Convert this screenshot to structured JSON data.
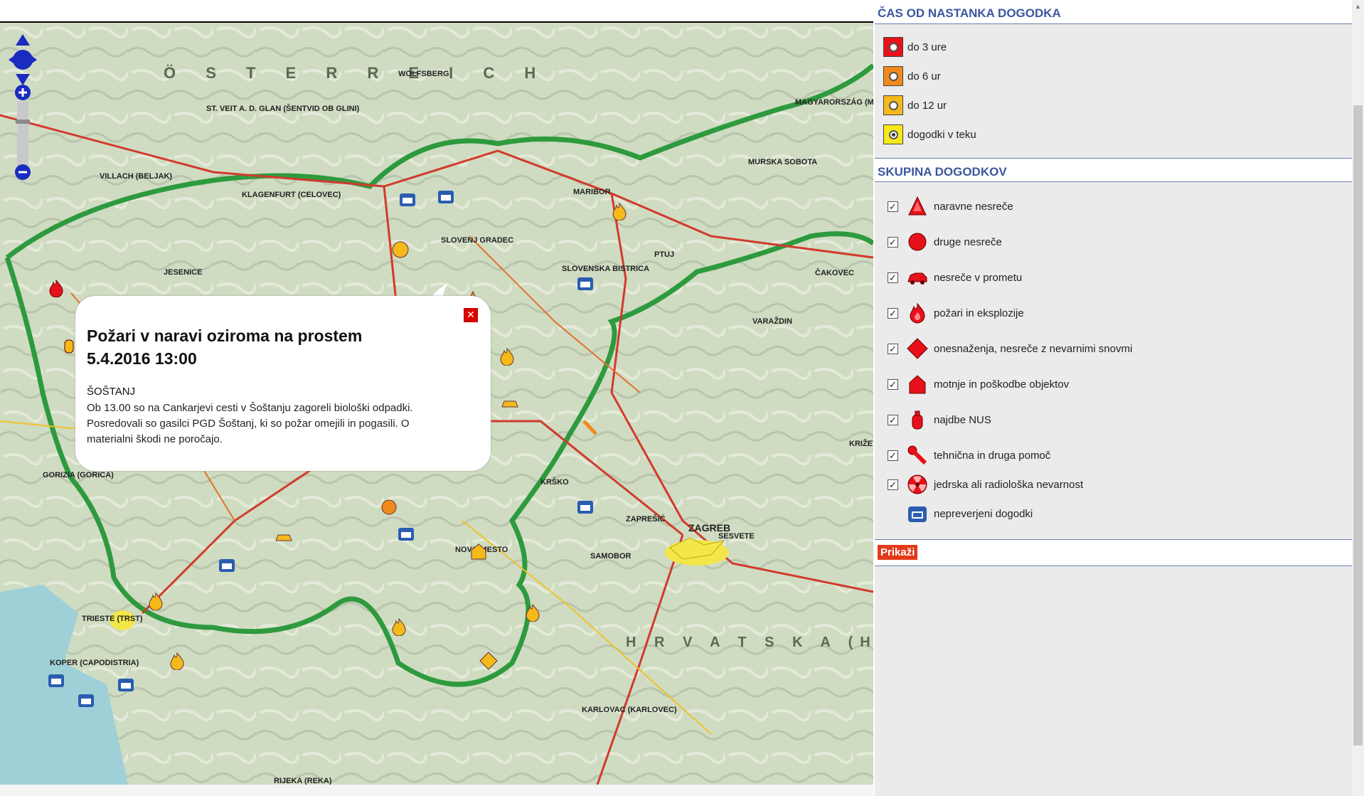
{
  "map": {
    "labels": [
      {
        "text": "Ö S T E R R E I C H",
        "cls": "country"
      },
      {
        "text": "KLAGENFURT (CELOVEC)"
      },
      {
        "text": "VILLACH (BELJAK)"
      },
      {
        "text": "ST. VEIT A. D. GLAN (ŠENTVID OB GLINI)"
      },
      {
        "text": "WOLFSBERG"
      },
      {
        "text": "MARIBOR"
      },
      {
        "text": "PTUJ"
      },
      {
        "text": "MURSKA SOBOTA"
      },
      {
        "text": "JESENICE"
      },
      {
        "text": "SLOVENJ GRADEC"
      },
      {
        "text": "SLOVENSKA BISTRICA"
      },
      {
        "text": "ČAKOVEC"
      },
      {
        "text": "VARAŽDIN"
      },
      {
        "text": "GORIZIA (GORICA)"
      },
      {
        "text": "TRIESTE (TRST)"
      },
      {
        "text": "KOPER (CAPODISTRIA)"
      },
      {
        "text": "KRŠKO"
      },
      {
        "text": "NOVO MESTO"
      },
      {
        "text": "ZAGREB"
      },
      {
        "text": "SESVETE"
      },
      {
        "text": "SAMOBOR"
      },
      {
        "text": "ZAPREŠIĆ"
      },
      {
        "text": "KARLOVAC (KARLOVEC)"
      },
      {
        "text": "RIJEKA (REKA)"
      },
      {
        "text": "KRIŽEVCI"
      },
      {
        "text": "H R V A T S K A (H R V A Š K A)",
        "cls": "country"
      },
      {
        "text": "MAGYARORSZÁG (MADŽARSKA)"
      }
    ]
  },
  "popup": {
    "title_line1": "Požari v naravi oziroma na prostem",
    "title_line2": "5.4.2016 13:00",
    "location": "ŠOŠTANJ",
    "body": "Ob 13.00 so na Cankarjevi cesti v Šoštanju zagoreli biološki odpadki. Posredovali so gasilci PGD Šoštanj, ki so požar omejili in pogasili. O materialni škodi ne poročajo.",
    "close_icon": "close-icon"
  },
  "sidebar": {
    "time_header": "ČAS OD NASTANKA DOGODKA",
    "time_legend": [
      {
        "label": "do 3 ure",
        "color": "#e8101a"
      },
      {
        "label": "do 6 ur",
        "color": "#f08a1a"
      },
      {
        "label": "do 12 ur",
        "color": "#f5b91a"
      },
      {
        "label": "dogodki v teku",
        "color": "#f8e81a"
      }
    ],
    "group_header": "SKUPINA DOGODKOV",
    "groups": [
      {
        "label": "naravne nesreče",
        "icon": "tree-icon",
        "checked": true
      },
      {
        "label": "druge nesreče",
        "icon": "circle-icon",
        "checked": true
      },
      {
        "label": "nesreče v prometu",
        "icon": "car-icon",
        "checked": true
      },
      {
        "label": "požari in eksplozije",
        "icon": "fire-icon",
        "checked": true
      },
      {
        "label": "onesnaženja, nesreče z nevarnimi snovmi",
        "icon": "diamond-icon",
        "checked": true
      },
      {
        "label": "motnje in poškodbe objektov",
        "icon": "house-icon",
        "checked": true
      },
      {
        "label": "najdbe NUS",
        "icon": "grenade-icon",
        "checked": true
      },
      {
        "label": "tehnična in druga pomoč",
        "icon": "wrench-icon",
        "checked": true
      },
      {
        "label": "jedrska ali radiološka nevarnost",
        "icon": "radiation-icon",
        "checked": true
      },
      {
        "label": "nepreverjeni dogodki",
        "icon": "phone-icon",
        "checked": false
      }
    ],
    "show_button": "Prikaži"
  }
}
